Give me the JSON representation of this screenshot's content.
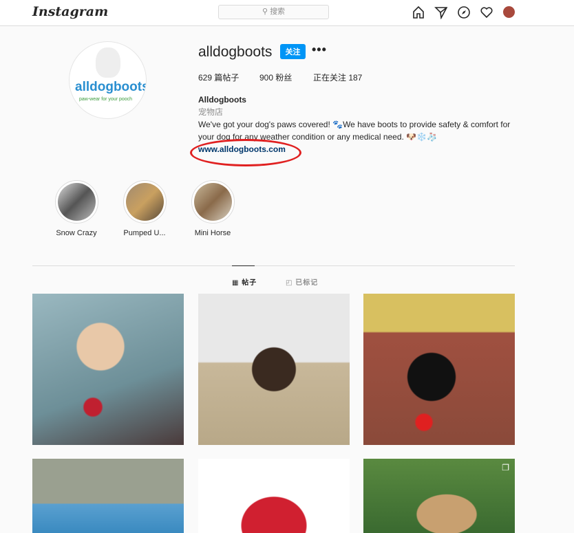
{
  "header": {
    "logo": "Instagram",
    "search_placeholder": "搜索",
    "icons": [
      "home-icon",
      "direct-message-icon",
      "explore-compass-icon",
      "heart-icon",
      "profile-avatar"
    ]
  },
  "profile": {
    "username": "alldogboots",
    "follow_label": "关注",
    "more_label": "•••",
    "posts": "629 篇帖子",
    "followers": "900 粉丝",
    "following": "正在关注 187",
    "name": "Alldogboots",
    "category": "宠物店",
    "bio": "We've got your dog's paws covered! 🐾We have boots to provide safety & comfort for your dog for any weather condition or any medical need. 🐶❄️🧦",
    "website": "www.alldogboots.com",
    "avatar_logo": "alldogboots",
    "avatar_tagline": "paw-wear for your pooch"
  },
  "highlights": [
    {
      "label": "Snow Crazy"
    },
    {
      "label": "Pumped U..."
    },
    {
      "label": "Mini Horse"
    }
  ],
  "tabs": [
    {
      "label": "帖子",
      "active": true
    },
    {
      "label": "已标记",
      "active": false
    }
  ],
  "posts_grid": [
    "chihuahua-red-boots",
    "dog-in-pet-store",
    "black-dog-red-boots",
    "dog-by-pool",
    "red-star-sweater",
    "yorkie-party-hat"
  ],
  "colors": {
    "accent": "#0095f6",
    "link": "#00376b",
    "annotation": "#e02020"
  }
}
